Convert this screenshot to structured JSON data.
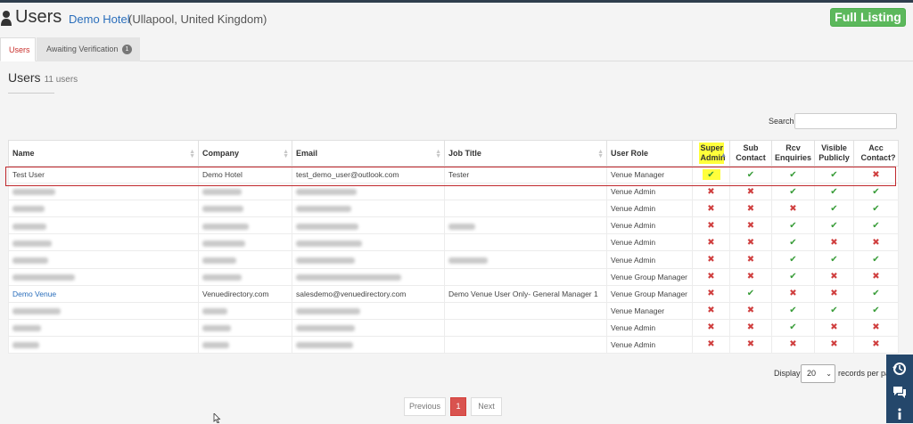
{
  "header": {
    "title": "Users",
    "hotel_name": "Demo Hotel",
    "hotel_location": "(Ullapool, United Kingdom)",
    "full_listing_label": "Full Listing"
  },
  "tabs": [
    {
      "label": "Users",
      "active": true
    },
    {
      "label": "Awaiting Verification",
      "badge": "1",
      "active": false
    }
  ],
  "section": {
    "title": "Users",
    "count": "11 users"
  },
  "search": {
    "label": "Search:",
    "value": ""
  },
  "table": {
    "columns": [
      "Name",
      "Company",
      "Email",
      "Job Title",
      "User Role",
      "Super Admin",
      "Sub Contact",
      "Rcv Enquiries",
      "Visible Publicly",
      "Acc Contact?"
    ],
    "sorted_column": "Super Admin",
    "rows": [
      {
        "name": "Test User",
        "company": "Demo Hotel",
        "email": "test_demo_user@outlook.com",
        "job": "Tester",
        "role": "Venue Manager",
        "flags": [
          true,
          true,
          true,
          true,
          false
        ],
        "highlighted": true
      },
      {
        "name": "",
        "company": "",
        "email": "",
        "job": "",
        "role": "Venue Admin",
        "flags": [
          false,
          false,
          true,
          true,
          true
        ]
      },
      {
        "name": "",
        "company": "",
        "email": "",
        "job": "",
        "role": "Venue Admin",
        "flags": [
          false,
          false,
          false,
          true,
          true
        ]
      },
      {
        "name": "",
        "company": "",
        "email": "",
        "job": "",
        "role": "Venue Admin",
        "flags": [
          false,
          false,
          true,
          true,
          true
        ]
      },
      {
        "name": "",
        "company": "",
        "email": "",
        "job": "",
        "role": "Venue Admin",
        "flags": [
          false,
          false,
          true,
          false,
          false
        ]
      },
      {
        "name": "",
        "company": "",
        "email": "",
        "job": "",
        "role": "Venue Admin",
        "flags": [
          false,
          false,
          true,
          true,
          true
        ]
      },
      {
        "name": "",
        "company": "",
        "email": "",
        "job": "",
        "role": "Venue Group Manager",
        "flags": [
          false,
          false,
          true,
          false,
          false
        ]
      },
      {
        "name": "Demo Venue",
        "company": "Venuedirectory.com",
        "email": "salesdemo@venuedirectory.com",
        "job": "Demo Venue User Only- General Manager 1",
        "role": "Venue Group Manager",
        "flags": [
          false,
          true,
          false,
          false,
          true
        ]
      },
      {
        "name": "",
        "company": "",
        "email": "",
        "job": "",
        "role": "Venue Manager",
        "flags": [
          false,
          false,
          true,
          true,
          true
        ]
      },
      {
        "name": "",
        "company": "",
        "email": "",
        "job": "",
        "role": "Venue Admin",
        "flags": [
          false,
          false,
          true,
          false,
          false
        ]
      },
      {
        "name": "",
        "company": "",
        "email": "",
        "job": "",
        "role": "Venue Admin",
        "flags": [
          false,
          false,
          false,
          false,
          false
        ]
      }
    ]
  },
  "footer": {
    "display_label": "Display",
    "page_size": "20",
    "records_label": "records per pa",
    "prev_label": "Previous",
    "current_page": "1",
    "next_label": "Next"
  },
  "icons": {
    "check": "✔",
    "cross": "✖",
    "dock": [
      "history-icon",
      "chat-icon",
      "info-icon"
    ]
  },
  "colors": {
    "accent_red": "#c0282d",
    "success_green": "#5cb85c",
    "link_blue": "#2a6ebb",
    "highlight_yellow": "#ffff3b",
    "dock_navy": "#24476b"
  }
}
